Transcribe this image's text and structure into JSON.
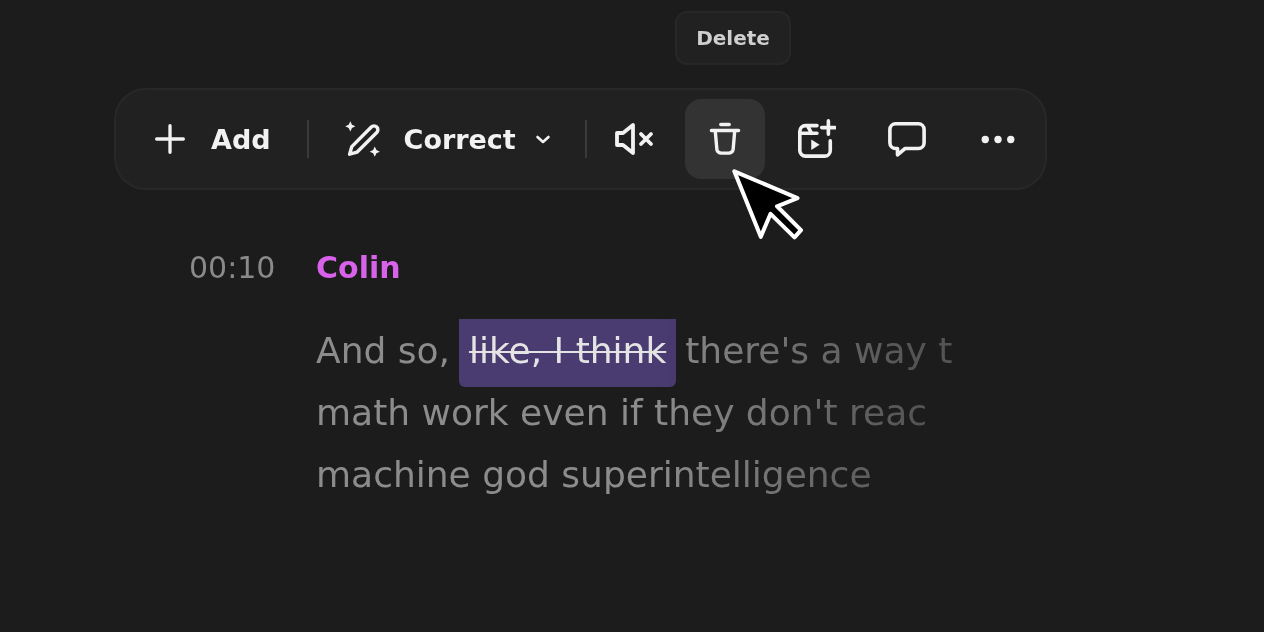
{
  "tooltip": {
    "text": "Delete"
  },
  "toolbar": {
    "groups": [
      {
        "items": [
          {
            "kind": "add",
            "label": "Add",
            "hovered": false
          }
        ]
      },
      {
        "items": [
          {
            "kind": "correct",
            "label": "Correct",
            "hovered": false
          }
        ]
      },
      {
        "items": [
          {
            "kind": "mute",
            "hovered": false
          },
          {
            "kind": "delete",
            "hovered": true
          },
          {
            "kind": "add_clip",
            "hovered": false
          },
          {
            "kind": "comment",
            "hovered": false
          },
          {
            "kind": "more",
            "hovered": false
          }
        ]
      }
    ]
  },
  "transcript": {
    "time": "00:10",
    "speaker": {
      "name": "Colin",
      "color": "#d862ea"
    },
    "lines": [
      {
        "parts": [
          {
            "text": "And so,",
            "deleted": false
          },
          {
            "text": "like, I think",
            "deleted": true
          },
          {
            "text": "there's a way t",
            "deleted": false
          }
        ]
      },
      {
        "parts": [
          {
            "text": "math work even if they don't reac",
            "deleted": false
          }
        ]
      },
      {
        "parts": [
          {
            "text": "machine god superintelligence",
            "deleted": false
          }
        ]
      }
    ]
  }
}
